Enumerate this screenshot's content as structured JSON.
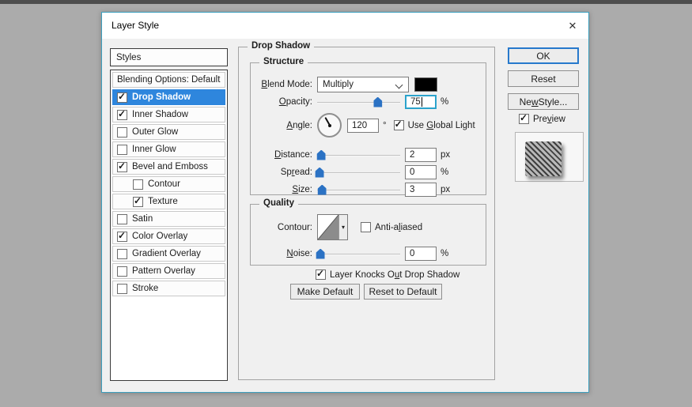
{
  "window": {
    "title": "Layer Style",
    "close_glyph": "✕"
  },
  "sidebar": {
    "header": "Styles",
    "items": [
      {
        "label": "Blending Options: Default",
        "checkbox": false,
        "checked": false,
        "selected": false,
        "indent": false
      },
      {
        "label": "Drop Shadow",
        "checkbox": true,
        "checked": true,
        "selected": true,
        "indent": false
      },
      {
        "label": "Inner Shadow",
        "checkbox": true,
        "checked": true,
        "selected": false,
        "indent": false
      },
      {
        "label": "Outer Glow",
        "checkbox": true,
        "checked": false,
        "selected": false,
        "indent": false
      },
      {
        "label": "Inner Glow",
        "checkbox": true,
        "checked": false,
        "selected": false,
        "indent": false
      },
      {
        "label": "Bevel and Emboss",
        "checkbox": true,
        "checked": true,
        "selected": false,
        "indent": false
      },
      {
        "label": "Contour",
        "checkbox": true,
        "checked": false,
        "selected": false,
        "indent": true
      },
      {
        "label": "Texture",
        "checkbox": true,
        "checked": true,
        "selected": false,
        "indent": true
      },
      {
        "label": "Satin",
        "checkbox": true,
        "checked": false,
        "selected": false,
        "indent": false
      },
      {
        "label": "Color Overlay",
        "checkbox": true,
        "checked": true,
        "selected": false,
        "indent": false
      },
      {
        "label": "Gradient Overlay",
        "checkbox": true,
        "checked": false,
        "selected": false,
        "indent": false
      },
      {
        "label": "Pattern Overlay",
        "checkbox": true,
        "checked": false,
        "selected": false,
        "indent": false
      },
      {
        "label": "Stroke",
        "checkbox": true,
        "checked": false,
        "selected": false,
        "indent": false
      }
    ]
  },
  "panel": {
    "title": "Drop Shadow",
    "structure": {
      "title": "Structure",
      "blend_mode": {
        "label": {
          "pre": "",
          "key": "B",
          "post": "lend Mode:"
        },
        "value": "Multiply",
        "swatch_color": "#000000"
      },
      "opacity": {
        "label": {
          "pre": "",
          "key": "O",
          "post": "pacity:"
        },
        "value": "75",
        "unit": "%",
        "slider_percent": 73
      },
      "angle": {
        "label": {
          "pre": "",
          "key": "A",
          "post": "ngle:"
        },
        "value": "120",
        "unit": "°",
        "degrees": 120,
        "use_global_light": {
          "label": {
            "pre": "Use ",
            "key": "G",
            "post": "lobal Light"
          },
          "checked": true
        }
      },
      "distance": {
        "label": {
          "pre": "",
          "key": "D",
          "post": "istance:"
        },
        "value": "2",
        "unit": "px",
        "slider_percent": 5
      },
      "spread": {
        "label": {
          "pre": "Sp",
          "key": "r",
          "post": "ead:"
        },
        "value": "0",
        "unit": "%",
        "slider_percent": 3
      },
      "size": {
        "label": {
          "pre": "",
          "key": "S",
          "post": "ize:"
        },
        "value": "3",
        "unit": "px",
        "slider_percent": 6
      }
    },
    "quality": {
      "title": "Quality",
      "contour": {
        "label": {
          "pre": "",
          "key": "",
          "post": "Contour:"
        },
        "dropdown_glyph": "▾"
      },
      "anti_aliased": {
        "label": {
          "pre": "Anti-a",
          "key": "l",
          "post": "iased"
        },
        "checked": false
      },
      "noise": {
        "label": {
          "pre": "",
          "key": "N",
          "post": "oise:"
        },
        "value": "0",
        "unit": "%",
        "slider_percent": 4
      }
    },
    "layer_knockout": {
      "label": {
        "pre": "Layer Knocks O",
        "key": "u",
        "post": "t Drop Shadow"
      },
      "checked": true
    },
    "buttons": {
      "make_default": "Make Default",
      "reset_to_default": "Reset to Default"
    }
  },
  "actions": {
    "ok": "OK",
    "reset": "Reset",
    "new_style": {
      "pre": "Ne",
      "key": "w",
      "post": " Style..."
    },
    "preview": {
      "label": {
        "pre": "Pre",
        "key": "v",
        "post": "iew"
      },
      "checked": true
    }
  },
  "colors": {
    "window_border": "#3c9fbe",
    "selection_blue": "#2e86dd",
    "slider_thumb_blue": "#2b72c4",
    "focus_field_border": "#2ba3cc",
    "blend_swatch": "#000000"
  }
}
